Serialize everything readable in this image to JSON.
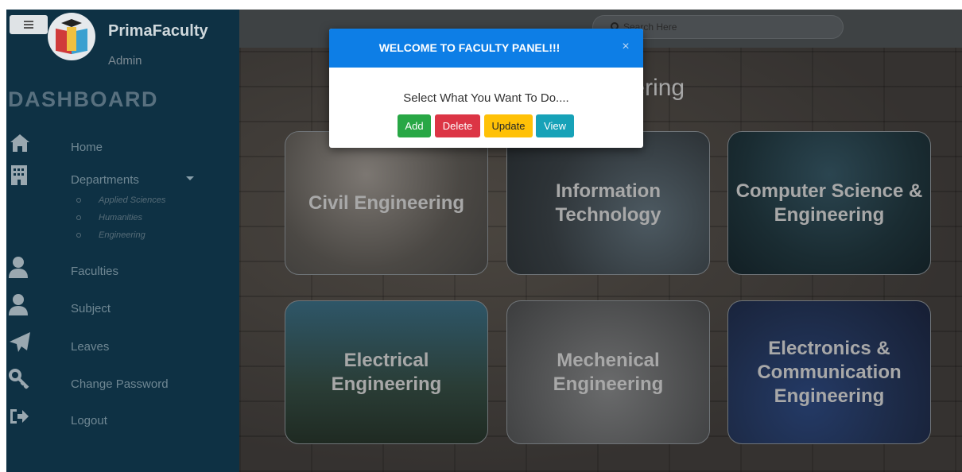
{
  "sidebar": {
    "brand": "PrimaFaculty",
    "role": "Admin",
    "dashboard_title": "DASHBOARD",
    "items": [
      {
        "label": "Home",
        "icon": "home-icon"
      },
      {
        "label": "Departments",
        "icon": "building-icon"
      },
      {
        "label": "Faculties",
        "icon": "user-icon"
      },
      {
        "label": "Subject",
        "icon": "user-icon"
      },
      {
        "label": "Leaves",
        "icon": "paper-plane-icon"
      },
      {
        "label": "Change Password",
        "icon": "key-icon"
      },
      {
        "label": "Logout",
        "icon": "logout-icon"
      }
    ],
    "departments_sub": [
      "Applied Sciences",
      "Humanities",
      "Engineering"
    ]
  },
  "search": {
    "placeholder": "Search Here"
  },
  "main": {
    "heading": "ngineering",
    "cards": [
      "Civil Engineering",
      "Information Technology",
      "Computer Science & Engineering",
      "Electrical Engineering",
      "Mechenical Engineering",
      "Electronics & Communication Engineering"
    ]
  },
  "modal": {
    "title": "WELCOME TO FACULTY PANEL!!!",
    "close": "×",
    "message": "Select What You Want To Do....",
    "buttons": {
      "add": "Add",
      "delete": "Delete",
      "update": "Update",
      "view": "View"
    }
  },
  "colors": {
    "sidebar_bg": "#0e3144",
    "modal_header": "#0d7ee6",
    "add": "#28a745",
    "delete": "#dc3545",
    "update": "#ffc107",
    "view": "#17a2b8"
  }
}
